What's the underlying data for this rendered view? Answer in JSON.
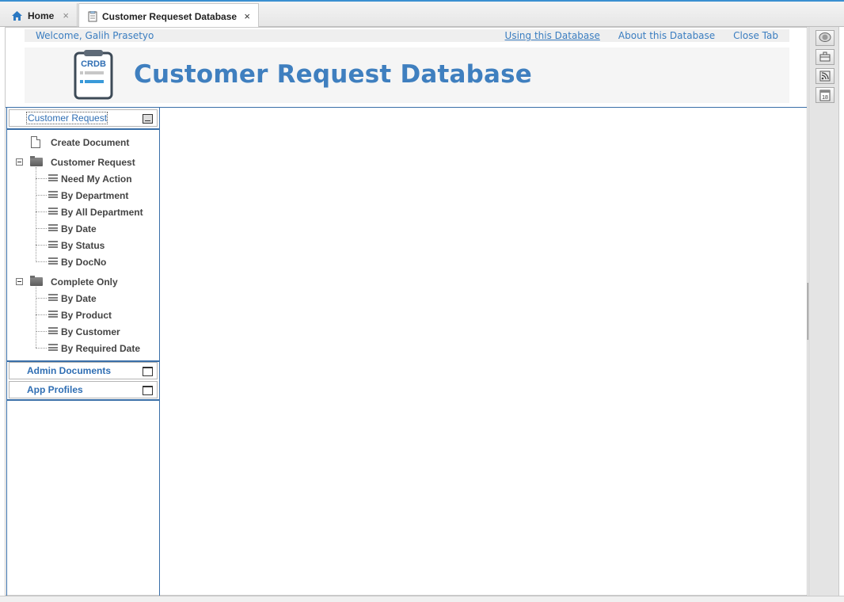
{
  "tabs": {
    "home_label": "Home",
    "active_label": "Customer Requeset Database",
    "close_glyph": "×"
  },
  "header": {
    "welcome": "Welcome, Galih Prasetyo",
    "links": {
      "using": "Using this Database",
      "about": "About this Database",
      "close": "Close Tab"
    },
    "logo_text": "CRDB",
    "title": "Customer Request Database"
  },
  "nav": {
    "section1": "Customer Request",
    "create_document": "Create Document",
    "group1": {
      "label": "Customer Request",
      "items": [
        "Need My Action",
        "By Department",
        "By All Department",
        "By Date",
        "By Status",
        "By DocNo"
      ]
    },
    "group2": {
      "label": "Complete Only",
      "items": [
        "By Date",
        "By Product",
        "By Customer",
        "By Required Date"
      ]
    },
    "section2": "Admin Documents",
    "section3": "App Profiles"
  },
  "toolbar": {
    "icons": [
      "chat-icon",
      "briefcase-icon",
      "rss-icon",
      "calendar-icon"
    ],
    "calendar_day": "18"
  },
  "colors": {
    "accent": "#3f7fbf",
    "link": "#3a7dc0",
    "tab_accent": "#3a8fd1"
  }
}
